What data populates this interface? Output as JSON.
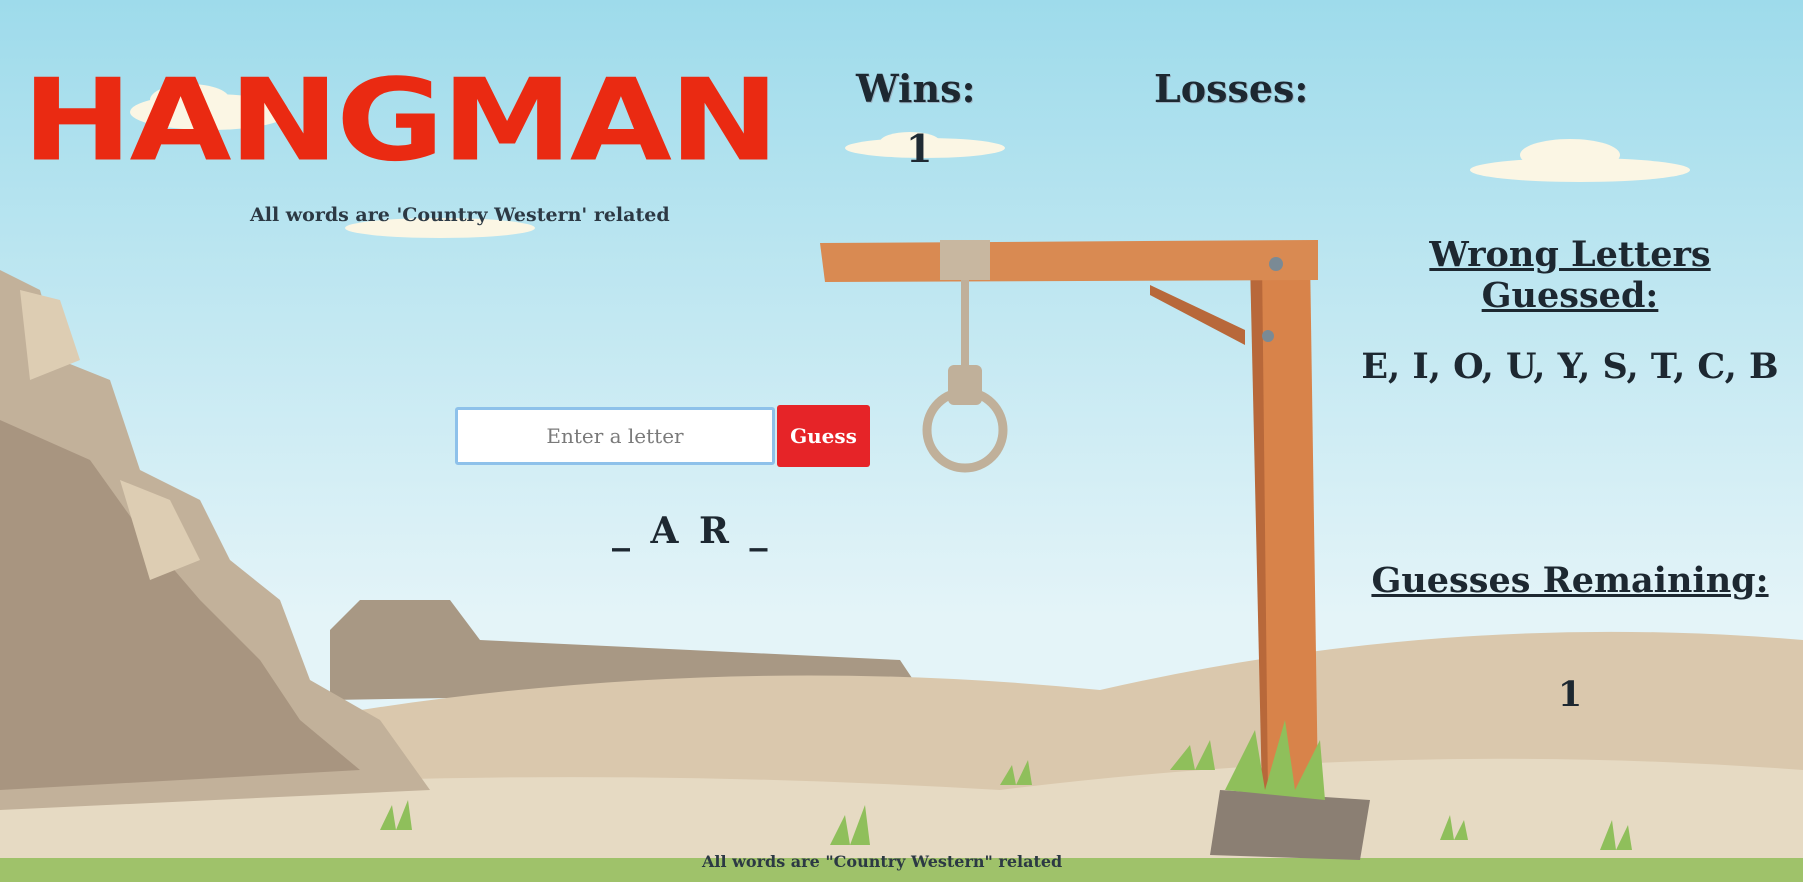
{
  "logo": {
    "title": "HANGMAN"
  },
  "subtitle": "All words are 'Country Western' related",
  "stats": {
    "wins_label": "Wins:",
    "wins_value": "1",
    "losses_label": "Losses:"
  },
  "input": {
    "placeholder": "Enter a letter",
    "value": ""
  },
  "guess_button": "Guess",
  "word_display": "_ A R _",
  "wrong": {
    "heading": "Wrong Letters Guessed:",
    "letters": "E, I, O, U, Y, S, T, C, B"
  },
  "remaining": {
    "heading": "Guesses Remaining:",
    "value": "1"
  },
  "footer": "All words are \"Country Western\" related",
  "colors": {
    "sky_top": "#9fdcec",
    "sky_bottom": "#e2f3f7",
    "logo_red": "#ea2a12",
    "button_red": "#e62428",
    "sand": "#dccbb0",
    "cliff": "#b9a991",
    "post_wood": "#d8834a",
    "grass": "#9fc26a"
  }
}
